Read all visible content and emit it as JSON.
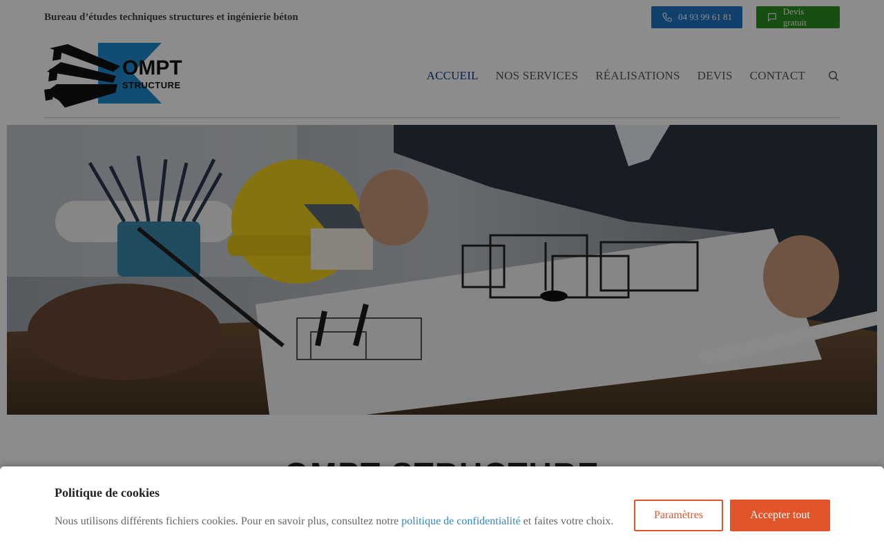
{
  "topbar": {
    "tagline": "Bureau d’études techniques structures et ingénierie béton",
    "phone_label": "04 93 99 61 81",
    "quote_label": "Devis gratuit"
  },
  "logo": {
    "line1": "OMPT",
    "line2": "STRUCTURE"
  },
  "nav": {
    "items": [
      "ACCUEIL",
      "NOS SERVICES",
      "RÉALISATIONS",
      "DEVIS",
      "CONTACT"
    ],
    "active": "ACCUEIL"
  },
  "page": {
    "heading": "OMPT STRUCTURE"
  },
  "cookie": {
    "title": "Politique de cookies",
    "text_before": "Nous utilisons différents fichiers cookies. Pour en savoir plus, consultez notre ",
    "link_text": "politique de confidentialité",
    "text_after": " et faites votre choix.",
    "params_label": "Paramètres",
    "accept_label": "Accepter tout"
  },
  "colors": {
    "phone_button": "#2176c7",
    "quote_button": "#2b8f21",
    "nav_active": "#0c3d8a",
    "cookie_accent": "#e2542a",
    "link": "#2f86c9",
    "logo_blue": "#1f8ad0"
  }
}
